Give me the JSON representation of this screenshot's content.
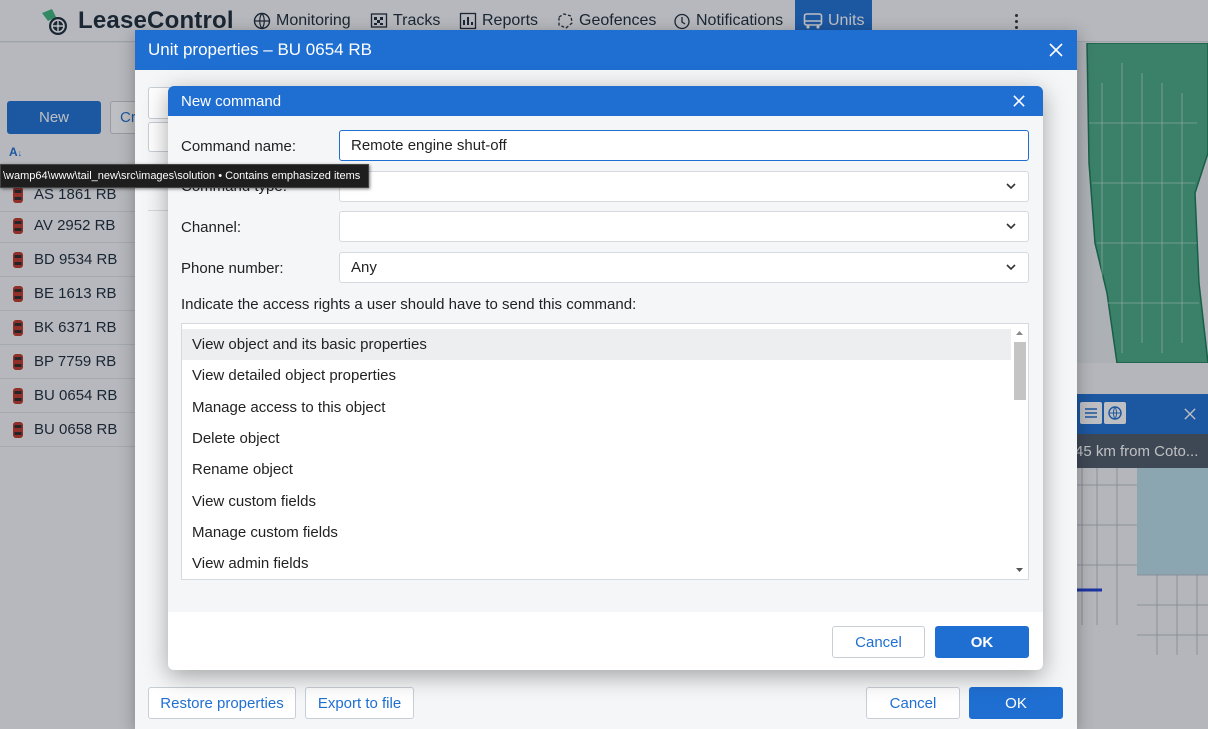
{
  "app": {
    "name": "LeaseControl"
  },
  "nav": [
    {
      "label": "Monitoring",
      "icon": "globe-icon"
    },
    {
      "label": "Tracks",
      "icon": "tracks-icon"
    },
    {
      "label": "Reports",
      "icon": "reports-icon"
    },
    {
      "label": "Geofences",
      "icon": "geofence-icon"
    },
    {
      "label": "Notifications",
      "icon": "bell-icon"
    },
    {
      "label": "Units",
      "icon": "units-icon",
      "active": true
    }
  ],
  "left_panel": {
    "new_label": "New",
    "cr_label": "Cr",
    "sort_label": "A",
    "units": [
      {
        "name": "AS 1861 RB"
      },
      {
        "name": "AV 2952 RB"
      },
      {
        "name": "BD 9534 RB"
      },
      {
        "name": "BE 1613 RB"
      },
      {
        "name": "BK 6371 RB"
      },
      {
        "name": "BP 7759 RB"
      },
      {
        "name": "BU 0654 RB"
      },
      {
        "name": "BU 0658 RB"
      }
    ]
  },
  "map": {
    "distance_text": "45 km from Coto..."
  },
  "unit_dialog": {
    "title": "Unit properties – BU 0654 RB",
    "restore_label": "Restore properties",
    "export_label": "Export to file",
    "cancel_label": "Cancel",
    "ok_label": "OK"
  },
  "command_dialog": {
    "title": "New command",
    "fields": {
      "name_label": "Command name:",
      "name_value": "Remote engine shut-off",
      "type_label": "Command type:",
      "type_value": "",
      "channel_label": "Channel:",
      "channel_value": "",
      "phone_label": "Phone number:",
      "phone_value": "Any"
    },
    "hint": "Indicate the access rights a user should have to send this command:",
    "rights": [
      "View object and its basic properties",
      "View detailed object properties",
      "Manage access to this object",
      "Delete object",
      "Rename object",
      "View custom fields",
      "Manage custom fields",
      "View admin fields"
    ],
    "cancel_label": "Cancel",
    "ok_label": "OK"
  },
  "tooltip": {
    "text": "\\wamp64\\www\\tail_new\\src\\images\\solution • Contains emphasized items"
  },
  "colors": {
    "accent": "#1f6fd2",
    "geofence": "#2e9e73",
    "car": "#c0392b"
  }
}
